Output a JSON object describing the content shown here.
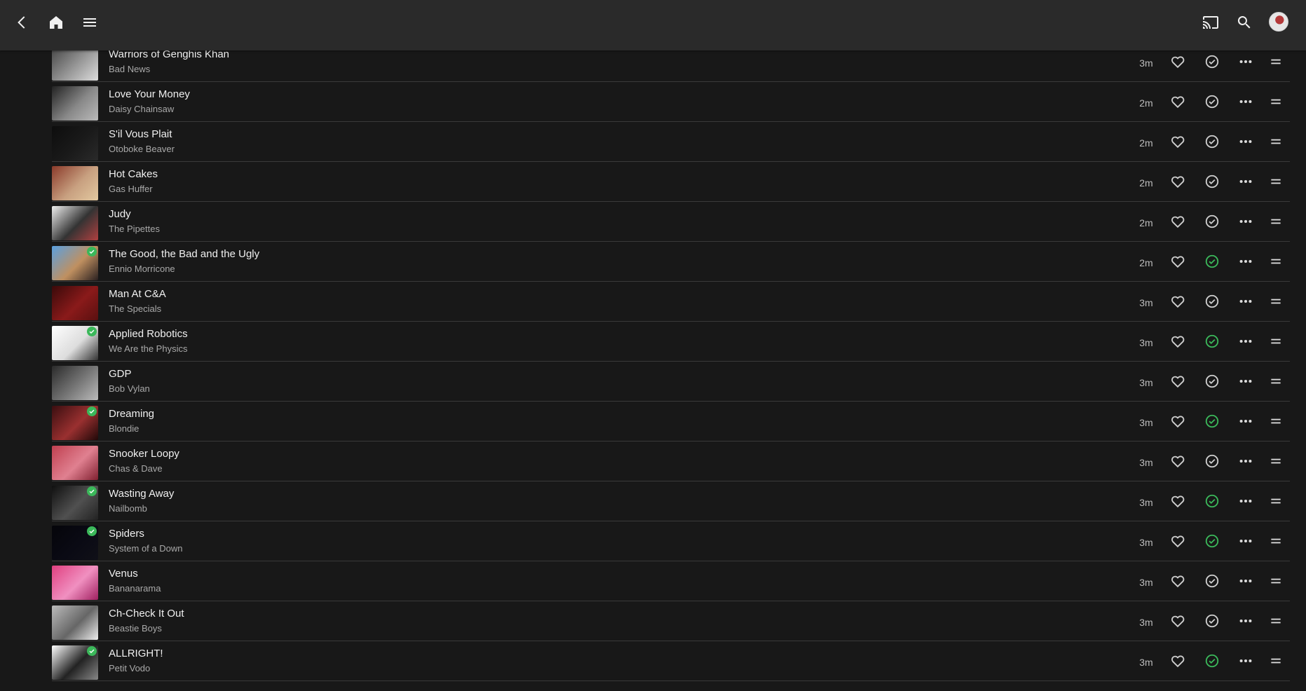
{
  "colors": {
    "background": "#181818",
    "topbar": "#2a2a2a",
    "accent_green": "#3bb85a",
    "icon": "#cfcfcf"
  },
  "topbar": {
    "left_icons": [
      "back-icon",
      "home-icon",
      "menu-icon"
    ],
    "right_icons": [
      "cast-icon",
      "search-icon",
      "avatar"
    ]
  },
  "tracks": [
    {
      "title": "Warriors of Genghis Khan",
      "artist": "Bad News",
      "duration": "3m",
      "played": false,
      "thumb": [
        "#444",
        "#999",
        "#ddd"
      ]
    },
    {
      "title": "Love Your Money",
      "artist": "Daisy Chainsaw",
      "duration": "2m",
      "played": false,
      "thumb": [
        "#222",
        "#888",
        "#bbb"
      ]
    },
    {
      "title": "S'il Vous Plait",
      "artist": "Otoboke Beaver",
      "duration": "2m",
      "played": false,
      "thumb": [
        "#0d0d0d",
        "#1a1a1a",
        "#2a2a2a"
      ]
    },
    {
      "title": "Hot Cakes",
      "artist": "Gas Huffer",
      "duration": "2m",
      "played": false,
      "thumb": [
        "#8a3a2a",
        "#c8a080",
        "#e3c9a0"
      ]
    },
    {
      "title": "Judy",
      "artist": "The Pipettes",
      "duration": "2m",
      "played": false,
      "thumb": [
        "#eeeeee",
        "#333333",
        "#b04040"
      ]
    },
    {
      "title": "The Good, the Bad and the Ugly",
      "artist": "Ennio Morricone",
      "duration": "2m",
      "played": true,
      "thumb": [
        "#5aa0e0",
        "#c09060",
        "#2a2020"
      ]
    },
    {
      "title": "Man At C&A",
      "artist": "The Specials",
      "duration": "3m",
      "played": false,
      "thumb": [
        "#3a0a0a",
        "#8a1a1a",
        "#5a1010"
      ]
    },
    {
      "title": "Applied Robotics",
      "artist": "We Are the Physics",
      "duration": "3m",
      "played": true,
      "thumb": [
        "#ffffff",
        "#dddddd",
        "#333333"
      ]
    },
    {
      "title": "GDP",
      "artist": "Bob Vylan",
      "duration": "3m",
      "played": false,
      "thumb": [
        "#2a2a2a",
        "#777777",
        "#bbbbbb"
      ]
    },
    {
      "title": "Dreaming",
      "artist": "Blondie",
      "duration": "3m",
      "played": true,
      "thumb": [
        "#3a0e10",
        "#9a3030",
        "#200808"
      ]
    },
    {
      "title": "Snooker Loopy",
      "artist": "Chas & Dave",
      "duration": "3m",
      "played": false,
      "thumb": [
        "#c04050",
        "#e08090",
        "#802030"
      ]
    },
    {
      "title": "Wasting Away",
      "artist": "Nailbomb",
      "duration": "3m",
      "played": true,
      "thumb": [
        "#101010",
        "#505050",
        "#222222"
      ]
    },
    {
      "title": "Spiders",
      "artist": "System of a Down",
      "duration": "3m",
      "played": true,
      "thumb": [
        "#05050a",
        "#0a0a14",
        "#101018"
      ]
    },
    {
      "title": "Venus",
      "artist": "Bananarama",
      "duration": "3m",
      "played": false,
      "thumb": [
        "#e04080",
        "#f090c0",
        "#a02060"
      ]
    },
    {
      "title": "Ch-Check It Out",
      "artist": "Beastie Boys",
      "duration": "3m",
      "played": false,
      "thumb": [
        "#bbbbbb",
        "#666666",
        "#eeeeee"
      ]
    },
    {
      "title": "ALLRIGHT!",
      "artist": "Petit Vodo",
      "duration": "3m",
      "played": true,
      "thumb": [
        "#ffffff",
        "#222222",
        "#888888"
      ]
    }
  ]
}
